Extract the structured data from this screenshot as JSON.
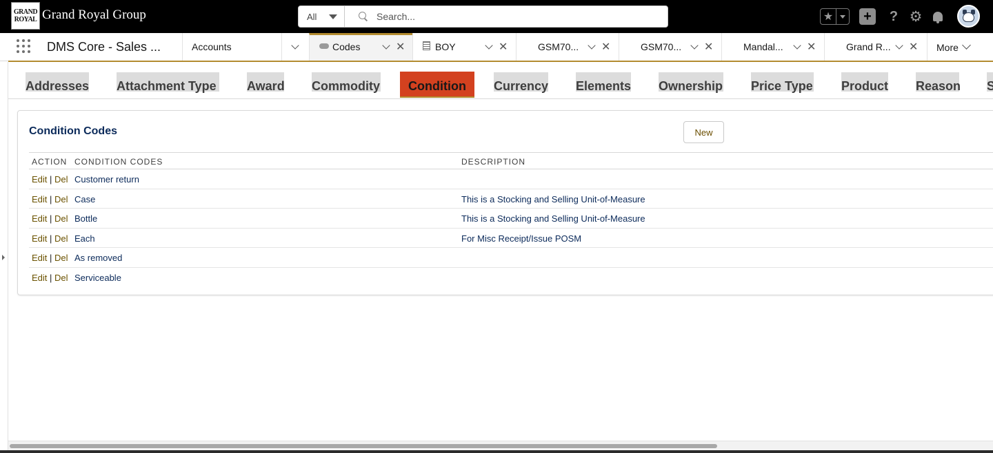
{
  "header": {
    "logo_line1": "GRAND",
    "logo_line2": "ROYAL",
    "brand": "Grand Royal Group",
    "search_scope": "All",
    "search_placeholder": "Search..."
  },
  "nav": {
    "app_name": "DMS Core - Sales ...",
    "tabs": [
      {
        "label": "Accounts"
      },
      {
        "label": "Codes"
      },
      {
        "label": "BOY"
      },
      {
        "label": "GSM70..."
      },
      {
        "label": "GSM70..."
      },
      {
        "label": "Mandal..."
      },
      {
        "label": "Grand R..."
      }
    ],
    "more_label": "More"
  },
  "subtabs": [
    "Addresses",
    "Attachment Type",
    "Award",
    "Commodity",
    "Condition",
    "Currency",
    "Elements",
    "Ownership",
    "Price Type",
    "Product",
    "Reason",
    "S"
  ],
  "active_subtab": "Condition",
  "card": {
    "title": "Condition Codes",
    "new_label": "New",
    "columns": [
      "ACTION",
      "CONDITION CODES",
      "DESCRIPTION"
    ],
    "edit_label": "Edit",
    "del_label": "Del",
    "separator": "|",
    "rows": [
      {
        "code": "Customer return",
        "description": ""
      },
      {
        "code": "Case",
        "description": "This is a Stocking and Selling Unit-of-Measure"
      },
      {
        "code": "Bottle",
        "description": "This is a Stocking and Selling Unit-of-Measure"
      },
      {
        "code": "Each",
        "description": "For Misc Receipt/Issue POSM"
      },
      {
        "code": "As removed",
        "description": ""
      },
      {
        "code": "Serviceable",
        "description": ""
      }
    ]
  },
  "colors": {
    "accent_gold": "#b38b2f",
    "active_subtab": "#d3411f",
    "link_navy": "#0b2a5a",
    "action_link": "#6b5200"
  }
}
